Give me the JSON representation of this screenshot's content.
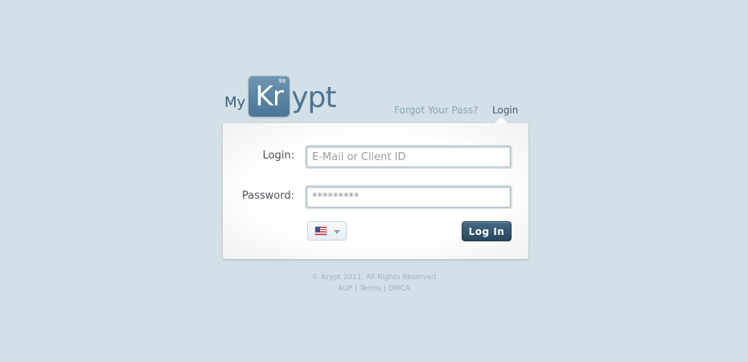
{
  "logo": {
    "prefix": "My",
    "tile_letters": "Kr",
    "tile_number": "98",
    "suffix": "ypt"
  },
  "nav": {
    "forgot_label": "Forgot Your Pass?",
    "login_label": "Login"
  },
  "form": {
    "login_label": "Login:",
    "login_placeholder": "E-Mail or Client ID",
    "login_value": "",
    "password_label": "Password:",
    "password_value": "*********",
    "language_flag_icon": "us-flag-icon",
    "language_caret_icon": "chevron-down-icon",
    "submit_label": "Log In"
  },
  "footer": {
    "copyright": "© Krypt 2011. All Rights Reserved",
    "links": [
      "AUP",
      "Terms",
      "DMCA"
    ],
    "separator": "|"
  },
  "colors": {
    "background": "#d3e0e8",
    "brand": "#4d7393",
    "button": "#27465c"
  }
}
